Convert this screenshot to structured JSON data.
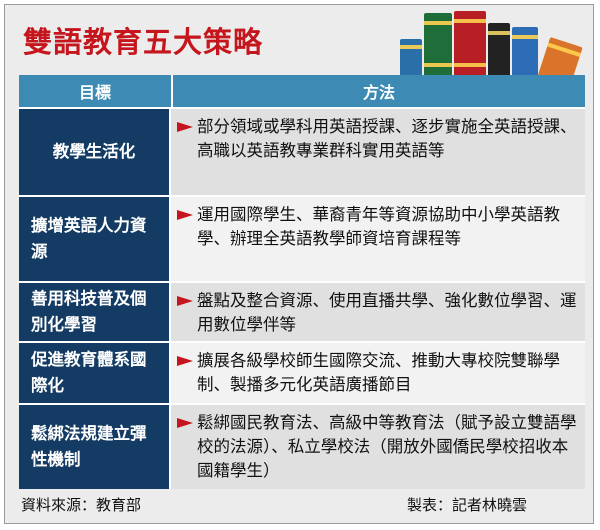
{
  "title": "雙語教育五大策略",
  "table": {
    "headers": {
      "goal": "目標",
      "method": "方法"
    },
    "rows": [
      {
        "goal": "教學生活化",
        "method": "部分領域或學科用英語授課、逐步實施全英語授課、高職以英語教專業群科實用英語等"
      },
      {
        "goal": "擴增英語人力資源",
        "method": "運用國際學生、華裔青年等資源協助中小學英語教學、辦理全英語教學師資培育課程等"
      },
      {
        "goal": "善用科技普及個別化學習",
        "method": "盤點及整合資源、使用直播共學、強化數位學習、運用數位學伴等"
      },
      {
        "goal": "促進教育體系國際化",
        "method": "擴展各級學校師生國際交流、推動大專校院雙聯學制、製播多元化英語廣播節目"
      },
      {
        "goal": "鬆綁法規建立彈性機制",
        "method": "鬆綁國民教育法、高級中等教育法（賦予設立雙語學校的法源）、私立學校法（開放外國僑民學校招收本國籍學生）"
      }
    ]
  },
  "footer": {
    "source": "資料來源：教育部",
    "credit": "製表：記者林曉雲"
  },
  "colors": {
    "title": "#c4161c",
    "header": "#3d8bb4",
    "goal_cell": "#143b63",
    "arrow": "#c4161c"
  },
  "icons": {
    "bullet": "red-triangle-arrow-icon",
    "decor": "books-illustration"
  }
}
